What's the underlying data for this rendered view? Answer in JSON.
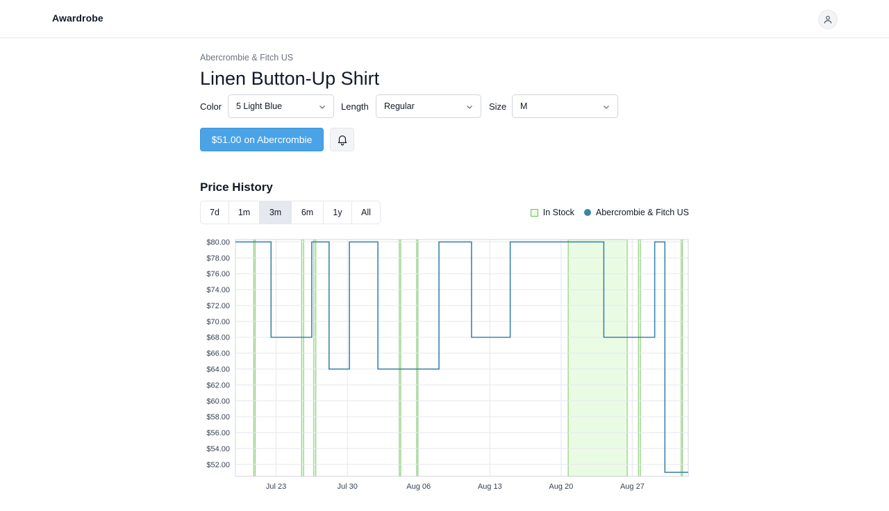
{
  "app": {
    "brand": "Awardrobe"
  },
  "product": {
    "retailer": "Abercrombie & Fitch US",
    "title": "Linen Button-Up Shirt",
    "options": [
      {
        "label": "Color",
        "value": "5 Light Blue"
      },
      {
        "label": "Length",
        "value": "Regular"
      },
      {
        "label": "Size",
        "value": "M"
      }
    ],
    "buy_label": "$51.00 on Abercrombie"
  },
  "icons": {
    "user": "user-icon",
    "bell": "bell-icon",
    "chevron": "chevron-down-icon"
  },
  "colors": {
    "accent": "#4aa3e6",
    "line": "#3a86a7",
    "stock_fill": "#eafbe4",
    "stock_line": "#6dbf5b"
  },
  "price_history": {
    "title": "Price History",
    "ranges": [
      "7d",
      "1m",
      "3m",
      "6m",
      "1y",
      "All"
    ],
    "active_range": "3m",
    "legend": [
      "In Stock",
      "Abercrombie & Fitch US"
    ]
  },
  "chart_data": {
    "type": "line",
    "step": true,
    "series": [
      {
        "name": "Abercrombie & Fitch US",
        "points": [
          [
            "Jul 19",
            80
          ],
          [
            "Jul 22.5",
            68
          ],
          [
            "Jul 26.5",
            80
          ],
          [
            "Jul 28.2",
            64
          ],
          [
            "Jul 30.2",
            80
          ],
          [
            "Aug 02",
            64
          ],
          [
            "Aug 08",
            80
          ],
          [
            "Aug 11.2",
            68
          ],
          [
            "Aug 15",
            80
          ],
          [
            "Aug 24.2",
            68
          ],
          [
            "Aug 29.2",
            80
          ],
          [
            "Aug 30.2",
            51
          ],
          [
            "Sep 01.5",
            51
          ]
        ]
      }
    ],
    "in_stock_bands": [
      [
        "Jul 20.8",
        "Jul 20.9"
      ],
      [
        "Jul 25.5",
        "Jul 25.7"
      ],
      [
        "Jul 26.7",
        "Jul 26.9"
      ],
      [
        "Aug 04.1",
        "Aug 04.2"
      ],
      [
        "Aug 05.8",
        "Aug 05.9"
      ],
      [
        "Aug 20.7",
        "Aug 26.5"
      ],
      [
        "Aug 27.6",
        "Aug 27.8"
      ],
      [
        "Aug 31.8",
        "Aug 31.9"
      ]
    ],
    "ylim": [
      50.5,
      80.3
    ],
    "yticks": [
      "$80.00",
      "$78.00",
      "$76.00",
      "$74.00",
      "$72.00",
      "$70.00",
      "$68.00",
      "$66.00",
      "$64.00",
      "$62.00",
      "$60.00",
      "$58.00",
      "$56.00",
      "$54.00",
      "$52.00"
    ],
    "xticks": [
      "Jul 23",
      "Jul 30",
      "Aug 06",
      "Aug 13",
      "Aug 20",
      "Aug 27"
    ],
    "grid": true,
    "legend_position": "top-right"
  }
}
